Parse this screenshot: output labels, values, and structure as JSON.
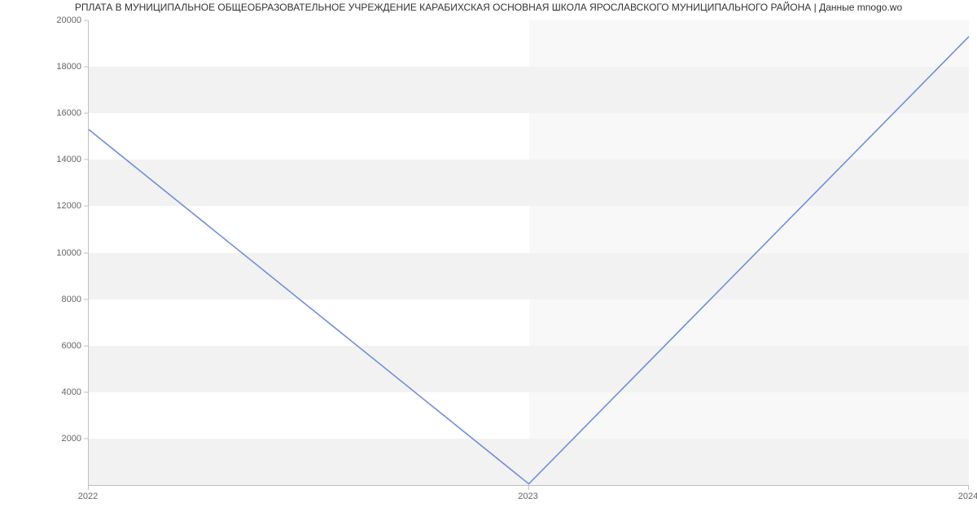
{
  "chart_data": {
    "type": "line",
    "title": "РПЛАТА В МУНИЦИПАЛЬНОЕ ОБЩЕОБРАЗОВАТЕЛЬНОЕ УЧРЕЖДЕНИЕ КАРАБИХСКАЯ ОСНОВНАЯ ШКОЛА ЯРОСЛАВСКОГО МУНИЦИПАЛЬНОГО РАЙОНА | Данные mnogo.wo",
    "x": [
      2022,
      2023,
      2024
    ],
    "values": [
      15300,
      50,
      19300
    ],
    "x_tick_labels": [
      "2022",
      "2023",
      "2024"
    ],
    "y_tick_labels": [
      "2000",
      "4000",
      "6000",
      "8000",
      "10000",
      "12000",
      "14000",
      "16000",
      "18000",
      "20000"
    ],
    "y_tick_values": [
      2000,
      4000,
      6000,
      8000,
      10000,
      12000,
      14000,
      16000,
      18000,
      20000
    ],
    "xlim": [
      2022,
      2024
    ],
    "ylim": [
      0,
      20000
    ],
    "xlabel": "",
    "ylabel": "",
    "line_color": "#6f8fd8"
  }
}
